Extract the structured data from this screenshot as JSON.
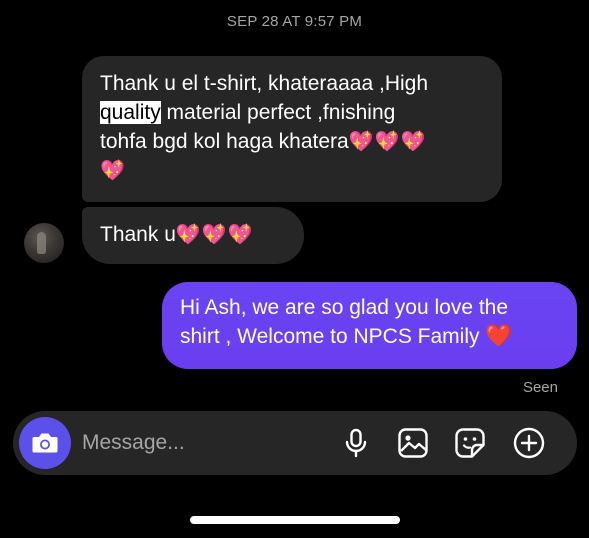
{
  "conversation": {
    "timestamp": "SEP 28 AT 9:57 PM",
    "messages": [
      {
        "direction": "incoming",
        "line1": "Thank u el t-shirt, khateraaaa ,High",
        "line2_highlight": "quality",
        "line2_rest": " material perfect ,fnishing",
        "line3_text": "tohfa bgd kol haga khatera",
        "line3_emoji": "💖💖💖",
        "line4_emoji": "💖"
      },
      {
        "direction": "incoming",
        "text": "Thank u",
        "emoji": "💖💖💖"
      },
      {
        "direction": "outgoing",
        "line1": "Hi Ash,  we are so glad you love the",
        "line2": "shirt , Welcome to NPCS Family ",
        "emoji": "❤️"
      }
    ],
    "seen_label": "Seen"
  },
  "composer": {
    "placeholder": "Message...",
    "icons": [
      "camera-icon",
      "microphone-icon",
      "gallery-icon",
      "sticker-icon",
      "plus-icon"
    ]
  },
  "colors": {
    "background": "#000000",
    "incoming_bubble": "#262626",
    "outgoing_bubble": "#6a44f2",
    "camera_button": "#5b51ea",
    "muted_text": "#a5a5a5"
  }
}
